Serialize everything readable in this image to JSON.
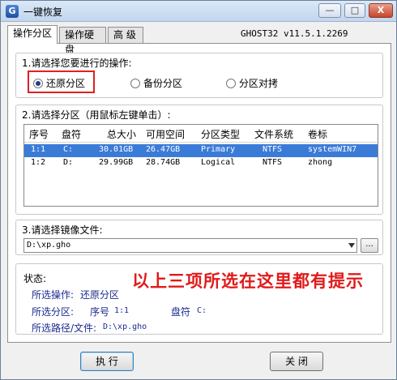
{
  "window": {
    "title": "一键恢复",
    "app_icon": "ghost-app-icon",
    "controls": {
      "minimize": "—",
      "maximize": "□",
      "close": "X"
    }
  },
  "tabs": [
    {
      "label": "操作分区",
      "active": true
    },
    {
      "label": "操作硬盘",
      "active": false
    },
    {
      "label": "高 级",
      "active": false
    }
  ],
  "version": "GHOST32 v11.5.1.2269",
  "step1": {
    "label": "1.请选择您要进行的操作:",
    "options": [
      {
        "label": "还原分区",
        "checked": true
      },
      {
        "label": "备份分区",
        "checked": false
      },
      {
        "label": "分区对拷",
        "checked": false
      }
    ]
  },
  "step2": {
    "label": "2.请选择分区（用鼠标左键单击）:",
    "columns": [
      "序号",
      "盘符",
      "总大小",
      "可用空间",
      "分区类型",
      "文件系统",
      "卷标"
    ],
    "rows": [
      [
        "1:1",
        "C:",
        "30.01GB",
        "26.47GB",
        "Primary",
        "NTFS",
        "systemWIN7"
      ],
      [
        "1:2",
        "D:",
        "29.99GB",
        "28.74GB",
        "Logical",
        "NTFS",
        "zhong"
      ]
    ],
    "selected_row": 0
  },
  "step3": {
    "label": "3.请选择镜像文件:",
    "value": "D:\\xp.gho",
    "browse_label": "..."
  },
  "status": {
    "title": "状态:",
    "note": "以上三项所选在这里都有提示",
    "op_label": "所选操作:",
    "op_value": "还原分区",
    "part_label": "所选分区:",
    "seq_label": "序号",
    "seq_value": "1:1",
    "drive_label": "盘符",
    "drive_value": "C:",
    "path_label": "所选路径/文件:",
    "path_value": "D:\\xp.gho"
  },
  "buttons": {
    "run": "执 行",
    "close": "关 闭"
  },
  "colors": {
    "highlight": "#e02020",
    "selection": "#3b7bd8",
    "note": "#e01b1b",
    "status_text": "#1a2b8f"
  }
}
